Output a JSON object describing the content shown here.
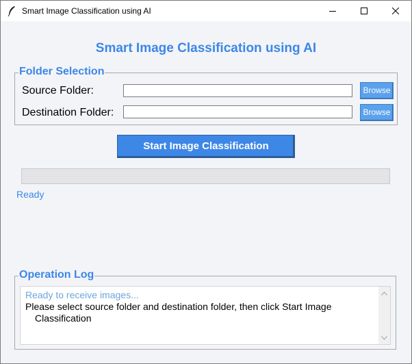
{
  "window": {
    "title": "Smart Image Classification using AI",
    "icon": "feather-icon",
    "controls": [
      "minimize-icon",
      "maximize-icon",
      "close-icon"
    ]
  },
  "heading": "Smart Image Classification using AI",
  "folder_selection": {
    "legend": "Folder Selection",
    "source_label": "Source Folder:",
    "source_value": "",
    "destination_label": "Destination Folder:",
    "destination_value": "",
    "browse_label": "Browse"
  },
  "start_button": "Start Image Classification",
  "progress": {
    "value": 0
  },
  "status": "Ready",
  "log": {
    "legend": "Operation Log",
    "lines": [
      "Ready to receive images...",
      "Please select source folder and destination folder, then click Start Image Classification"
    ]
  },
  "colors": {
    "accent": "#3d87e6",
    "browse": "#5ba1ec",
    "log_info": "#6fa4dd"
  }
}
